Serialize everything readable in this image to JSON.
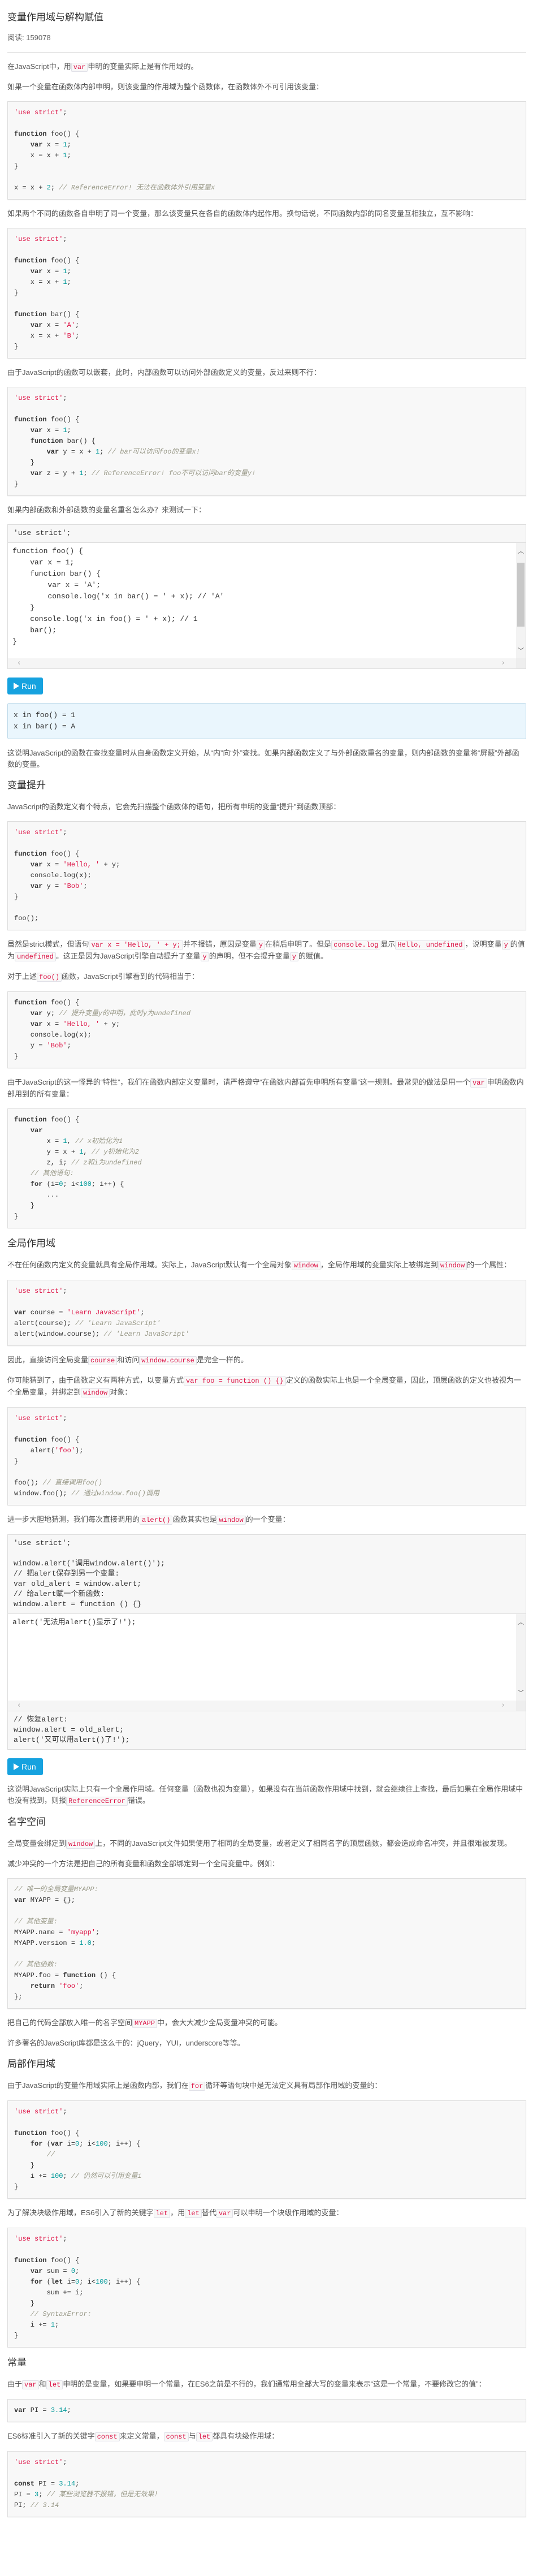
{
  "article": {
    "title": "变量作用域与解构赋值",
    "reads": "阅读: 159078",
    "blocks": [
      {
        "type": "p",
        "parts": [
          "在JavaScript中，用",
          {
            "c": "var"
          },
          "申明的变量实际上是有作用域的。"
        ]
      },
      {
        "type": "p",
        "parts": [
          "如果一个变量在函数体内部申明，则该变量的作用域为整个函数体，在函数体外不可引用该变量："
        ]
      },
      {
        "type": "code",
        "lines": [
          "⟦s|'use strict'⟧;",
          "",
          "⟦k|function⟧ foo() {",
          "    ⟦k|var⟧ x = ⟦n|1⟧;",
          "    x = x + ⟦n|1⟧;",
          "}",
          "",
          "x = x + ⟦n|2⟧; ⟦c|// ReferenceError! 无法在函数体外引用变量x⟧"
        ]
      },
      {
        "type": "p",
        "parts": [
          "如果两个不同的函数各自申明了同一个变量，那么该变量只在各自的函数体内起作用。换句话说，不同函数内部的同名变量互相独立，互不影响："
        ]
      },
      {
        "type": "code",
        "lines": [
          "⟦s|'use strict'⟧;",
          "",
          "⟦k|function⟧ foo() {",
          "    ⟦k|var⟧ x = ⟦n|1⟧;",
          "    x = x + ⟦n|1⟧;",
          "}",
          "",
          "⟦k|function⟧ bar() {",
          "    ⟦k|var⟧ x = ⟦s|'A'⟧;",
          "    x = x + ⟦s|'B'⟧;",
          "}"
        ]
      },
      {
        "type": "p",
        "parts": [
          "由于JavaScript的函数可以嵌套，此时，内部函数可以访问外部函数定义的变量，反过来则不行："
        ]
      },
      {
        "type": "code",
        "lines": [
          "⟦s|'use strict'⟧;",
          "",
          "⟦k|function⟧ foo() {",
          "    ⟦k|var⟧ x = ⟦n|1⟧;",
          "    ⟦k|function⟧ bar() {",
          "        ⟦k|var⟧ y = x + ⟦n|1⟧; ⟦c|// bar可以访问foo的变量x!⟧",
          "    }",
          "    ⟦k|var⟧ z = y + ⟦n|1⟧; ⟦c|// ReferenceError! foo不可以访问bar的变量y!⟧",
          "}"
        ]
      },
      {
        "type": "p",
        "parts": [
          "如果内部函数和外部函数的变量名重名怎么办？来测试一下："
        ]
      },
      {
        "type": "editor",
        "head": [
          "'use strict';"
        ],
        "body": [
          "function foo() {",
          "    var x = 1;",
          "    function bar() {",
          "        var x = 'A';",
          "        console.log('x in bar() = ' + x); // 'A'",
          "    }",
          "    console.log('x in foo() = ' + x); // 1",
          "    bar();",
          "}"
        ],
        "foot": []
      },
      {
        "type": "run",
        "label": "Run"
      },
      {
        "type": "output",
        "lines": [
          "x in foo() = 1",
          "x in bar() = A"
        ]
      },
      {
        "type": "p",
        "parts": [
          "这说明JavaScript的函数在查找变量时从自身函数定义开始，从“内”向“外”查找。如果内部函数定义了与外部函数重名的变量，则内部函数的变量将“屏蔽”外部函数的变量。"
        ]
      },
      {
        "type": "h",
        "text": "变量提升"
      },
      {
        "type": "p",
        "parts": [
          "JavaScript的函数定义有个特点，它会先扫描整个函数体的语句，把所有申明的变量“提升”到函数顶部："
        ]
      },
      {
        "type": "code",
        "lines": [
          "⟦s|'use strict'⟧;",
          "",
          "⟦k|function⟧ foo() {",
          "    ⟦k|var⟧ x = ⟦s|'Hello, '⟧ + y;",
          "    console.log(x);",
          "    ⟦k|var⟧ y = ⟦s|'Bob'⟧;",
          "}",
          "",
          "foo();"
        ]
      },
      {
        "type": "p",
        "parts": [
          "虽然是strict模式，但语句",
          {
            "c": "var x = 'Hello, ' + y;"
          },
          "并不报错，原因是变量",
          {
            "c": "y"
          },
          "在稍后申明了。但是",
          {
            "c": "console.log"
          },
          "显示",
          {
            "c": "Hello, undefined"
          },
          "，说明变量",
          {
            "c": "y"
          },
          "的值为",
          {
            "c": "undefined"
          },
          "。这正是因为JavaScript引擎自动提升了变量",
          {
            "c": "y"
          },
          "的声明，但不会提升变量",
          {
            "c": "y"
          },
          "的赋值。"
        ]
      },
      {
        "type": "p",
        "parts": [
          "对于上述",
          {
            "c": "foo()"
          },
          "函数，JavaScript引擎看到的代码相当于："
        ]
      },
      {
        "type": "code",
        "lines": [
          "⟦k|function⟧ foo() {",
          "    ⟦k|var⟧ y; ⟦c|// 提升变量y的申明，此时y为undefined⟧",
          "    ⟦k|var⟧ x = ⟦s|'Hello, '⟧ + y;",
          "    console.log(x);",
          "    y = ⟦s|'Bob'⟧;",
          "}"
        ]
      },
      {
        "type": "p",
        "parts": [
          "由于JavaScript的这一怪异的“特性”，我们在函数内部定义变量时，请严格遵守“在函数内部首先申明所有变量”这一规则。最常见的做法是用一个",
          {
            "c": "var"
          },
          "申明函数内部用到的所有变量："
        ]
      },
      {
        "type": "code",
        "lines": [
          "⟦k|function⟧ foo() {",
          "    ⟦k|var⟧",
          "        x = ⟦n|1⟧, ⟦c|// x初始化为1⟧",
          "        y = x + ⟦n|1⟧, ⟦c|// y初始化为2⟧",
          "        z, i; ⟦c|// z和i为undefined⟧",
          "    ⟦c|// 其他语句:⟧",
          "    ⟦k|for⟧ (i=⟦n|0⟧; i<⟦n|100⟧; i++) {",
          "        ...",
          "    }",
          "}"
        ]
      },
      {
        "type": "h",
        "text": "全局作用域"
      },
      {
        "type": "p",
        "parts": [
          "不在任何函数内定义的变量就具有全局作用域。实际上，JavaScript默认有一个全局对象",
          {
            "c": "window"
          },
          "，全局作用域的变量实际上被绑定到",
          {
            "c": "window"
          },
          "的一个属性："
        ]
      },
      {
        "type": "code",
        "lines": [
          "⟦s|'use strict'⟧;",
          "",
          "⟦k|var⟧ course = ⟦s|'Learn JavaScript'⟧;",
          "alert(course); ⟦c|// 'Learn JavaScript'⟧",
          "alert(window.course); ⟦c|// 'Learn JavaScript'⟧"
        ]
      },
      {
        "type": "p",
        "parts": [
          "因此，直接访问全局变量",
          {
            "c": "course"
          },
          "和访问",
          {
            "c": "window.course"
          },
          "是完全一样的。"
        ]
      },
      {
        "type": "p",
        "parts": [
          "你可能猜到了，由于函数定义有两种方式，以变量方式",
          {
            "c": "var foo = function () {}"
          },
          "定义的函数实际上也是一个全局变量，因此，顶层函数的定义也被视为一个全局变量，并绑定到",
          {
            "c": "window"
          },
          "对象："
        ]
      },
      {
        "type": "code",
        "lines": [
          "⟦s|'use strict'⟧;",
          "",
          "⟦k|function⟧ foo() {",
          "    alert(⟦s|'foo'⟧);",
          "}",
          "",
          "foo(); ⟦c|// 直接调用foo()⟧",
          "window.foo(); ⟦c|// 通过window.foo()调用⟧"
        ]
      },
      {
        "type": "p",
        "parts": [
          "进一步大胆地猜测，我们每次直接调用的",
          {
            "c": "alert()"
          },
          "函数其实也是",
          {
            "c": "window"
          },
          "的一个变量："
        ]
      },
      {
        "type": "editor",
        "head": [
          "'use strict';",
          "",
          "window.alert('调用window.alert()');",
          "// 把alert保存到另一个变量:",
          "var old_alert = window.alert;",
          "// 给alert赋一个新函数:",
          "window.alert = function () {}"
        ],
        "body": [
          "alert('无法用alert()显示了!');"
        ],
        "foot": [
          "// 恢复alert:",
          "window.alert = old_alert;",
          "alert('又可以用alert()了!');"
        ]
      },
      {
        "type": "run",
        "label": "Run"
      },
      {
        "type": "p",
        "parts": [
          "这说明JavaScript实际上只有一个全局作用域。任何变量（函数也视为变量），如果没有在当前函数作用域中找到，就会继续往上查找，最后如果在全局作用域中也没有找到，则报",
          {
            "c": "ReferenceError"
          },
          "错误。"
        ]
      },
      {
        "type": "h",
        "text": "名字空间"
      },
      {
        "type": "p",
        "parts": [
          "全局变量会绑定到",
          {
            "c": "window"
          },
          "上，不同的JavaScript文件如果使用了相同的全局变量，或者定义了相同名字的顶层函数，都会造成命名冲突，并且很难被发现。"
        ]
      },
      {
        "type": "p",
        "parts": [
          "减少冲突的一个方法是把自己的所有变量和函数全部绑定到一个全局变量中。例如："
        ]
      },
      {
        "type": "code",
        "lines": [
          "⟦c|// 唯一的全局变量MYAPP:⟧",
          "⟦k|var⟧ MYAPP = {};",
          "",
          "⟦c|// 其他变量:⟧",
          "MYAPP.name = ⟦s|'myapp'⟧;",
          "MYAPP.version = ⟦n|1.0⟧;",
          "",
          "⟦c|// 其他函数:⟧",
          "MYAPP.foo = ⟦k|function⟧ () {",
          "    ⟦k|return⟧ ⟦s|'foo'⟧;",
          "};"
        ]
      },
      {
        "type": "p",
        "parts": [
          "把自己的代码全部放入唯一的名字空间",
          {
            "c": "MYAPP"
          },
          "中，会大大减少全局变量冲突的可能。"
        ]
      },
      {
        "type": "p",
        "parts": [
          "许多著名的JavaScript库都是这么干的：jQuery，YUI，underscore等等。"
        ]
      },
      {
        "type": "h",
        "text": "局部作用域"
      },
      {
        "type": "p",
        "parts": [
          "由于JavaScript的变量作用域实际上是函数内部，我们在",
          {
            "c": "for"
          },
          "循环等语句块中是无法定义具有局部作用域的变量的："
        ]
      },
      {
        "type": "code",
        "lines": [
          "⟦s|'use strict'⟧;",
          "",
          "⟦k|function⟧ foo() {",
          "    ⟦k|for⟧ (⟦k|var⟧ i=⟦n|0⟧; i<⟦n|100⟧; i++) {",
          "        ⟦c|//⟧",
          "    }",
          "    i += ⟦n|100⟧; ⟦c|// 仍然可以引用变量i⟧",
          "}"
        ]
      },
      {
        "type": "p",
        "parts": [
          "为了解决块级作用域，ES6引入了新的关键字",
          {
            "c": "let"
          },
          "，用",
          {
            "c": "let"
          },
          "替代",
          {
            "c": "var"
          },
          "可以申明一个块级作用域的变量："
        ]
      },
      {
        "type": "code",
        "lines": [
          "⟦s|'use strict'⟧;",
          "",
          "⟦k|function⟧ foo() {",
          "    ⟦k|var⟧ sum = ⟦n|0⟧;",
          "    ⟦k|for⟧ (⟦k|let⟧ i=⟦n|0⟧; i<⟦n|100⟧; i++) {",
          "        sum += i;",
          "    }",
          "    ⟦c|// SyntaxError:⟧",
          "    i += ⟦n|1⟧;",
          "}"
        ]
      },
      {
        "type": "h",
        "text": "常量"
      },
      {
        "type": "p",
        "parts": [
          "由于",
          {
            "c": "var"
          },
          "和",
          {
            "c": "let"
          },
          "申明的是变量，如果要申明一个常量，在ES6之前是不行的，我们通常用全部大写的变量来表示“这是一个常量，不要修改它的值”："
        ]
      },
      {
        "type": "code",
        "lines": [
          "⟦k|var⟧ PI = ⟦n|3.14⟧;"
        ]
      },
      {
        "type": "p",
        "parts": [
          "ES6标准引入了新的关键字",
          {
            "c": "const"
          },
          "来定义常量，",
          {
            "c": "const"
          },
          "与",
          {
            "c": "let"
          },
          "都具有块级作用域："
        ]
      },
      {
        "type": "code",
        "lines": [
          "⟦s|'use strict'⟧;",
          "",
          "⟦k|const⟧ PI = ⟦n|3.14⟧;",
          "PI = ⟦n|3⟧; ⟦c|// 某些浏览器不报错，但是无效果！⟧",
          "PI; ⟦c|// 3.14⟧"
        ]
      }
    ]
  },
  "colors": {
    "run_button": "#16a2df",
    "inline_code": "#dd1144",
    "string": "#dd1144",
    "number": "#009999",
    "comment": "#999988",
    "output_bg": "#eaf6fd"
  },
  "icons": {
    "run": "play-triangle-icon",
    "scroll_up": "chevron-up-icon",
    "scroll_down": "chevron-down-icon",
    "scroll_left": "chevron-left-icon",
    "scroll_right": "chevron-right-icon"
  }
}
